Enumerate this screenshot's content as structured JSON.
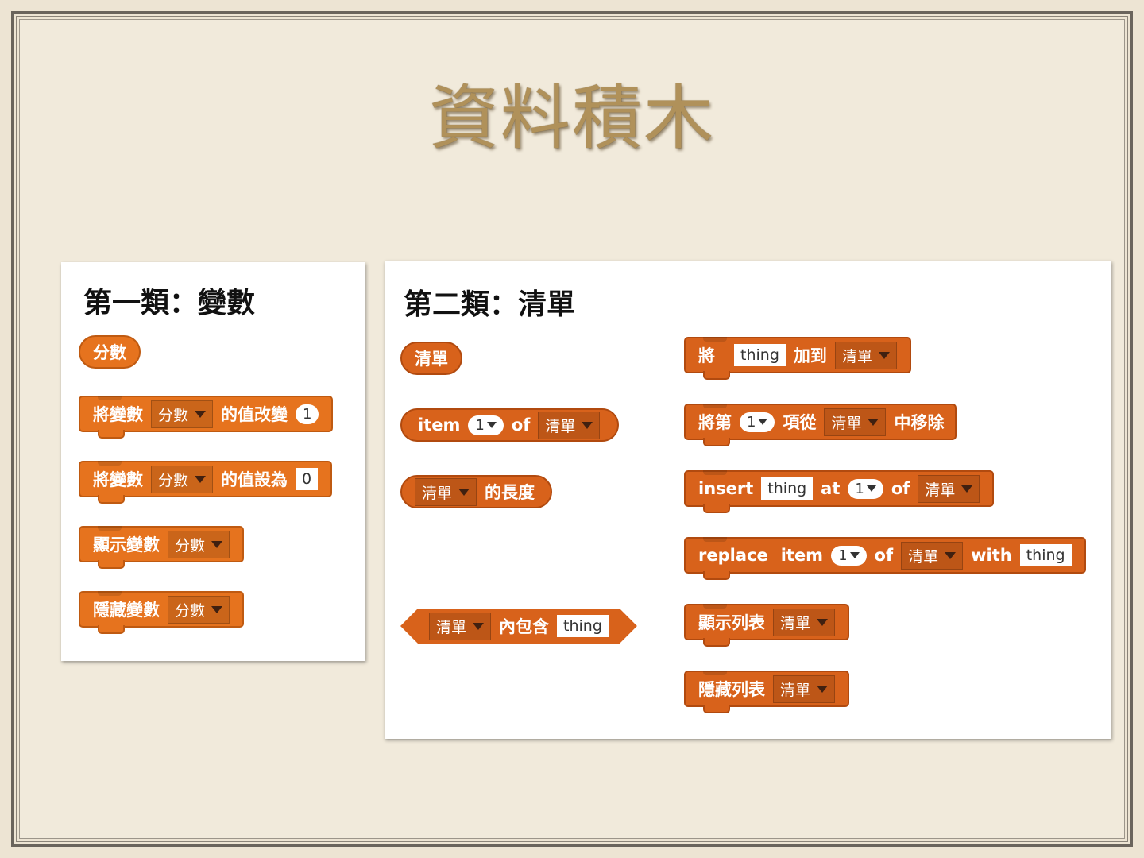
{
  "slide": {
    "title": "資料積木"
  },
  "variables_panel": {
    "heading": "第一類：變數",
    "reporter": "分數",
    "change_block": {
      "label": "將變數",
      "var": "分數",
      "action": "的值改變",
      "value": "1"
    },
    "set_block": {
      "label": "將變數",
      "var": "分數",
      "action": "的值設為",
      "value": "0"
    },
    "show_block": {
      "label": "顯示變數",
      "var": "分數"
    },
    "hide_block": {
      "label": "隱藏變數",
      "var": "分數"
    }
  },
  "lists_panel": {
    "heading": "第二類：清單",
    "list_reporter": "清單",
    "item_block": {
      "label": "item",
      "index": "1",
      "of": "of",
      "list": "清單"
    },
    "length_block": {
      "list": "清單",
      "label": "的長度"
    },
    "contains_block": {
      "list": "清單",
      "label": "內包含",
      "value": "thing"
    },
    "add_block": {
      "label": "將",
      "value": "thing",
      "action": "加到",
      "list": "清單"
    },
    "delete_block": {
      "label": "將第",
      "index": "1",
      "mid": "項從",
      "list": "清單",
      "action": "中移除"
    },
    "insert_block": {
      "label": "insert",
      "value": "thing",
      "at": "at",
      "index": "1",
      "of": "of",
      "list": "清單"
    },
    "replace_block": {
      "label": "replace",
      "item": "item",
      "index": "1",
      "of": "of",
      "list": "清單",
      "with": "with",
      "value": "thing"
    },
    "show_list_block": {
      "label": "顯示列表",
      "list": "清單"
    },
    "hide_list_block": {
      "label": "隱藏列表",
      "list": "清單"
    }
  },
  "colors": {
    "variable_block": "#e6731e",
    "list_block": "#d8621b",
    "title": "#b0915a"
  }
}
